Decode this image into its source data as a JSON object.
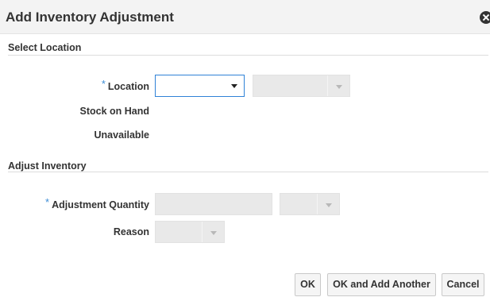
{
  "dialog": {
    "title": "Add Inventory Adjustment",
    "close_icon": "close-circle-icon"
  },
  "sections": {
    "select_location": "Select Location",
    "adjust_inventory": "Adjust Inventory"
  },
  "fields": {
    "location": {
      "required_marker": "*",
      "label": "Location",
      "value": ""
    },
    "stock_on_hand": {
      "label": "Stock on Hand",
      "value": ""
    },
    "unavailable": {
      "label": "Unavailable",
      "value": ""
    },
    "adjustment_quantity": {
      "required_marker": "*",
      "label": "Adjustment Quantity",
      "value": ""
    },
    "reason": {
      "label": "Reason",
      "value": ""
    }
  },
  "buttons": {
    "ok": "OK",
    "ok_add_another": "OK and Add Another",
    "cancel": "Cancel"
  },
  "colors": {
    "accent": "#2f82d7",
    "required": "#3c8dd6",
    "disabled": "#e9e9e9"
  }
}
